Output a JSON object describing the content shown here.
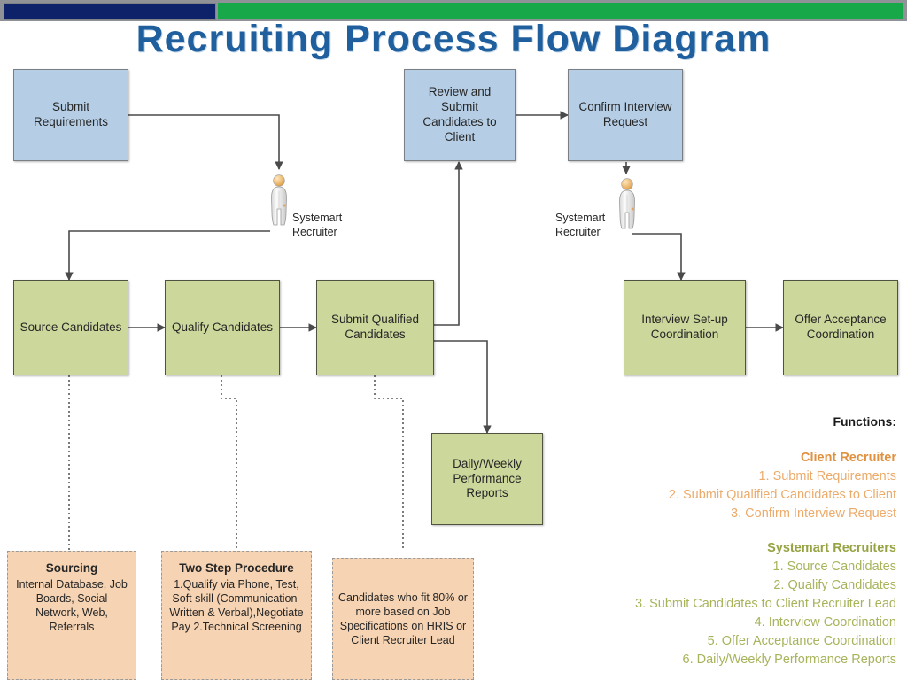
{
  "banner": {
    "left_bar_color": "#0d2269",
    "right_bar_color": "#17a84a"
  },
  "title": "Recruiting Process Flow Diagram",
  "nodes": {
    "submit_requirements": "Submit Requirements",
    "review_and_submit": "Review and Submit Candidates to Client",
    "confirm_interview": "Confirm Interview Request",
    "source_candidates": "Source Candidates",
    "qualify_candidates": "Qualify Candidates",
    "submit_qualified": "Submit Qualified Candidates",
    "interview_setup": "Interview Set-up Coordination",
    "offer_acceptance": "Offer Acceptance Coordination",
    "daily_weekly": "Daily/Weekly Performance Reports"
  },
  "actors": [
    {
      "name": "Systemart Recruiter",
      "label": "Systemart\nRecruiter"
    },
    {
      "name": "Systemart Recruiter",
      "label": "Systemart\nRecruiter"
    }
  ],
  "notes": {
    "sourcing": {
      "heading": "Sourcing",
      "body": "Internal Database, Job Boards, Social Network, Web, Referrals"
    },
    "two_step": {
      "heading": "Two Step Procedure",
      "body": "1.Qualify via Phone, Test, Soft skill (Communication-Written & Verbal),Negotiate Pay 2.Technical Screening"
    },
    "fit_criteria": {
      "heading": "",
      "body": "Candidates who fit 80% or more based on Job Specifications on HRIS or Client Recruiter Lead"
    }
  },
  "legend": {
    "title": "Functions:",
    "groups": [
      {
        "heading": "Client Recruiter",
        "color": "#e0913f",
        "items": [
          "1. Submit Requirements",
          "2. Submit Qualified Candidates to Client",
          "3. Confirm Interview Request"
        ]
      },
      {
        "heading": "Systemart Recruiters",
        "color": "#97a342",
        "items": [
          "1. Source Candidates",
          "2. Qualify Candidates",
          "3. Submit Candidates to Client Recruiter Lead",
          "4. Interview Coordination",
          "5. Offer Acceptance Coordination",
          "6. Daily/Weekly Performance Reports"
        ]
      }
    ]
  },
  "colors": {
    "blue_node": "#b5cee5",
    "green_node": "#ccd79b",
    "peach_note": "#f6d3b2",
    "title_blue": "#1f5f9e"
  }
}
